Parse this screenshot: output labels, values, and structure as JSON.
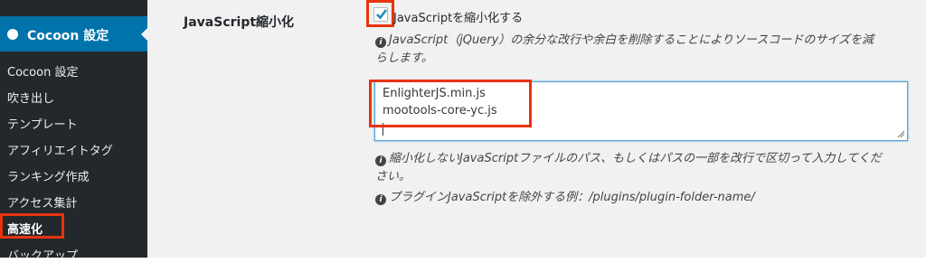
{
  "sidebar": {
    "active_menu": "Cocoon 設定",
    "items": [
      {
        "label": "Cocoon 設定"
      },
      {
        "label": "吹き出し"
      },
      {
        "label": "テンプレート"
      },
      {
        "label": "アフィリエイトタグ"
      },
      {
        "label": "ランキング作成"
      },
      {
        "label": "アクセス集計"
      },
      {
        "label": "高速化"
      },
      {
        "label": "バックアップ"
      }
    ],
    "current_item": "高速化"
  },
  "setting": {
    "label": "JavaScript縮小化",
    "checkbox_label": "JavaScriptを縮小化する",
    "checked": true,
    "help_line1": "JavaScript（jQuery）の余分な改行や余白を削除することによりソースコードのサイズを減",
    "help_line2": "らします。",
    "exclude_files": [
      "EnlighterJS.min.js",
      "mootools-core-yc.js"
    ],
    "help2_line1": "縮小化しないJavaScriptファイルのパス、もしくはパスの一部を改行で区切って入力してくだ",
    "help2_line2": "さい。",
    "help3": "プラグインJavaScriptを除外する例：/plugins/plugin-folder-name/",
    "info_glyph": "i"
  },
  "colors": {
    "sidebar_bg": "#23282d",
    "active_bg": "#0073aa",
    "highlight": "#e8330d",
    "content_bg": "#f1f1f1"
  }
}
